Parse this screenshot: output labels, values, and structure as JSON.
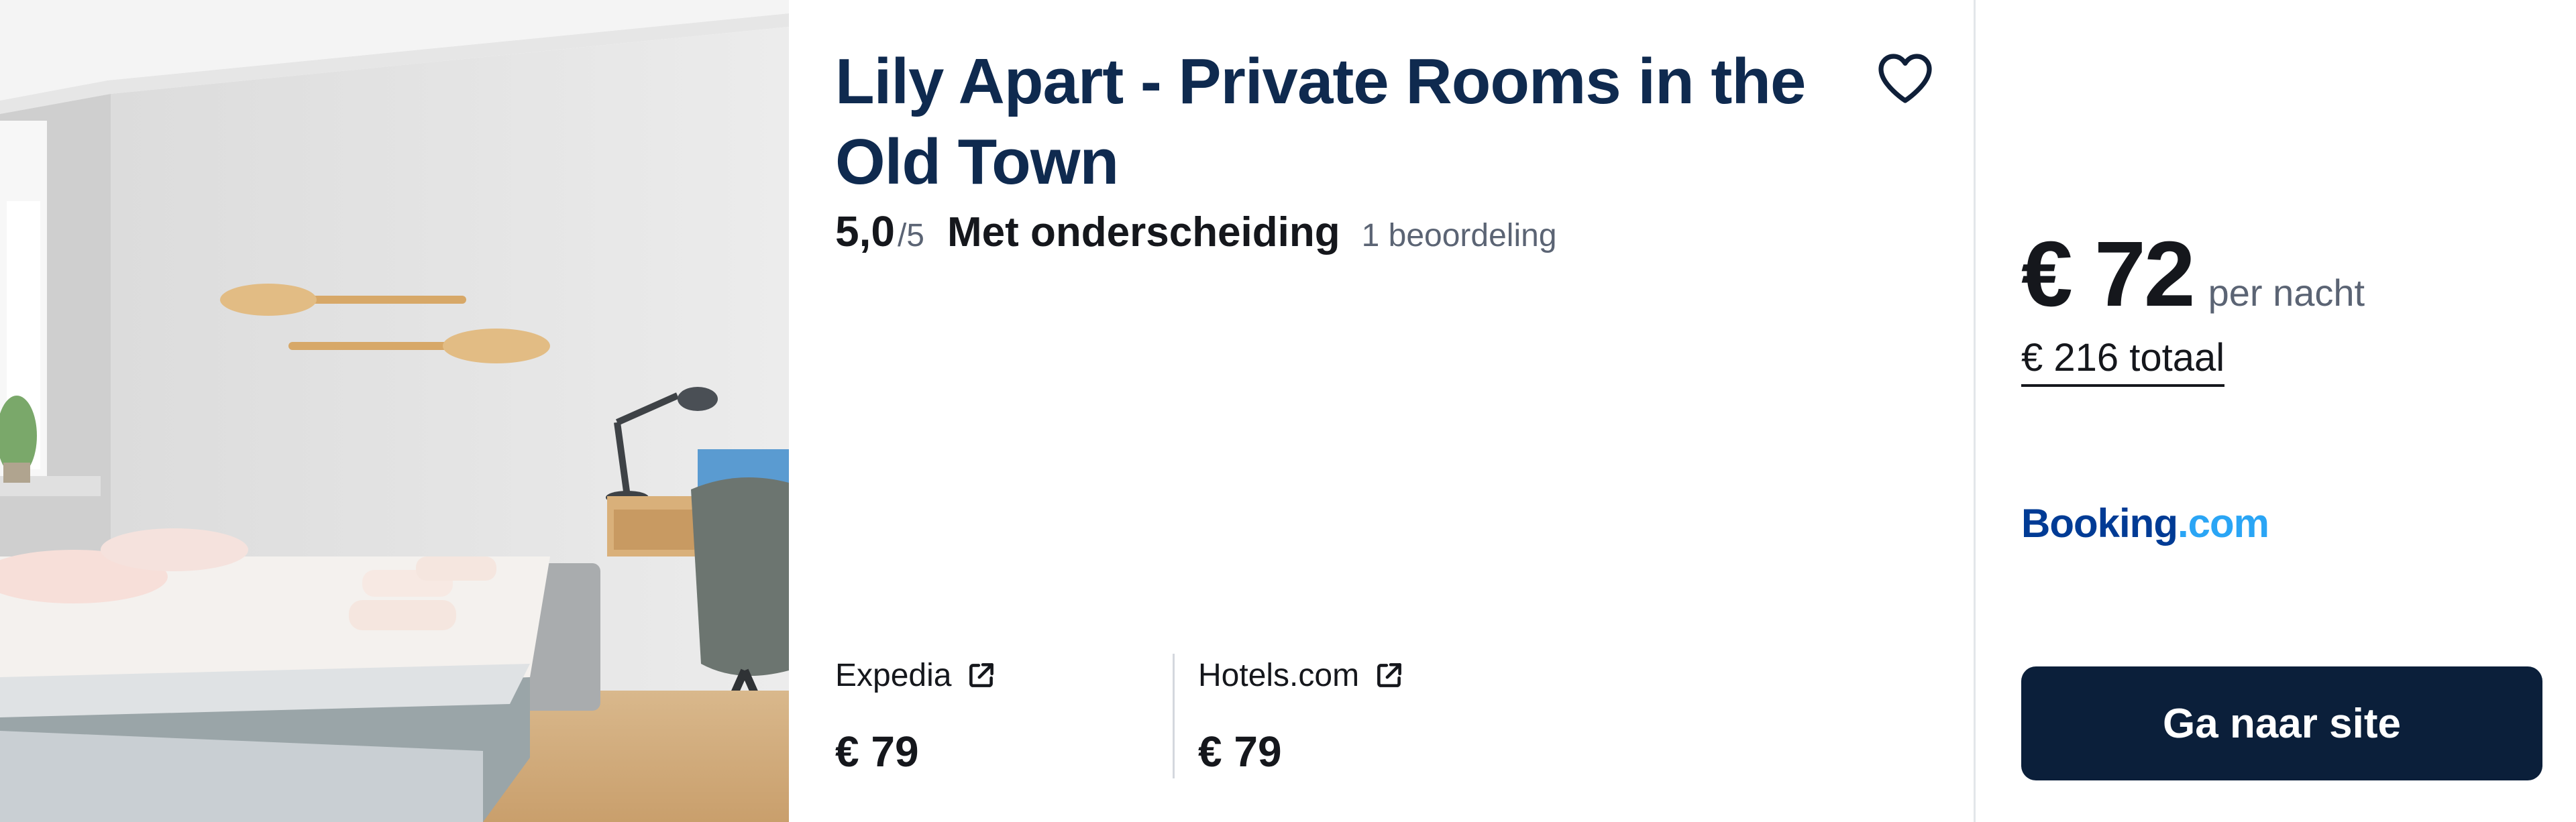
{
  "listing": {
    "title": "Lily Apart - Private Rooms in the Old Town",
    "rating": {
      "score": "5,0",
      "max": "/5",
      "label": "Met onderscheiding",
      "reviews": "1 beoordeling"
    },
    "providers": [
      {
        "name": "Expedia",
        "price": "€ 79",
        "icon": "external-link-icon"
      },
      {
        "name": "Hotels.com",
        "price": "€ 79",
        "icon": "external-link-icon"
      }
    ]
  },
  "offer": {
    "price": "€ 72",
    "price_unit": "per nacht",
    "total": "€ 216 totaal",
    "brand_part1": "Booking",
    "brand_part2": ".com",
    "cta": "Ga naar site"
  },
  "icons": {
    "favorite": "heart-icon",
    "external": "external-link-icon"
  },
  "colors": {
    "title": "#0f2a4f",
    "cta_bg": "#0b1f3a",
    "brand_dark": "#003b95",
    "brand_light": "#2aa5f5",
    "muted": "#5b6474"
  }
}
